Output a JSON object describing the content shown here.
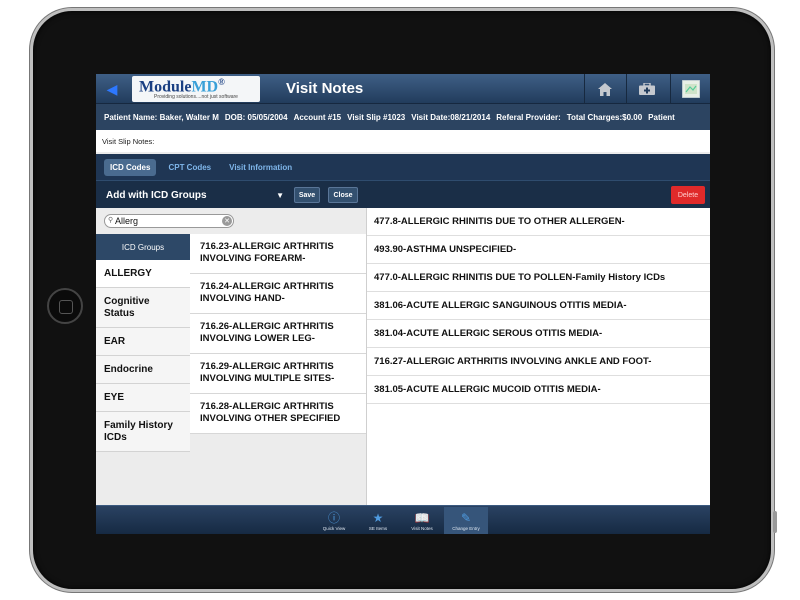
{
  "header": {
    "logo_main": "Module",
    "logo_accent": "MD",
    "logo_reg": "®",
    "logo_tagline": "Providing solutions....not just software",
    "title": "Visit Notes"
  },
  "patient_bar": {
    "items": [
      "Patient Name: Baker, Walter M",
      "DOB: 05/05/2004",
      "Account #15",
      "Visit Slip #1023",
      "Visit Date:08/21/2014",
      "Referal Provider:",
      "Total Charges:$0.00",
      "Patient"
    ]
  },
  "slip_notes_label": "Visit Slip Notes:",
  "tabs": [
    {
      "label": "ICD Codes"
    },
    {
      "label": "CPT Codes"
    },
    {
      "label": "Visit Information"
    }
  ],
  "actions": {
    "group_select": "Add with ICD Groups",
    "save": "Save",
    "close": "Close",
    "delete": "Delete"
  },
  "search": {
    "value": "Allerg"
  },
  "groups_header": "ICD Groups",
  "groups": [
    {
      "label": "ALLERGY"
    },
    {
      "label": "Cognitive Status"
    },
    {
      "label": "EAR"
    },
    {
      "label": "Endocrine"
    },
    {
      "label": "EYE"
    },
    {
      "label": "Family History ICDs"
    }
  ],
  "codes": [
    {
      "label": "716.23-ALLERGIC ARTHRITIS INVOLVING FOREARM-"
    },
    {
      "label": "716.24-ALLERGIC ARTHRITIS INVOLVING HAND-"
    },
    {
      "label": "716.26-ALLERGIC ARTHRITIS INVOLVING LOWER LEG-"
    },
    {
      "label": "716.29-ALLERGIC ARTHRITIS INVOLVING MULTIPLE SITES-"
    },
    {
      "label": "716.28-ALLERGIC ARTHRITIS INVOLVING OTHER SPECIFIED"
    }
  ],
  "selected_codes": [
    {
      "label": "477.8-ALLERGIC RHINITIS DUE TO OTHER ALLERGEN-"
    },
    {
      "label": "493.90-ASTHMA UNSPECIFIED-"
    },
    {
      "label": "477.0-ALLERGIC RHINITIS DUE TO POLLEN-Family History ICDs"
    },
    {
      "label": "381.06-ACUTE ALLERGIC SANGUINOUS OTITIS MEDIA-"
    },
    {
      "label": "381.04-ACUTE ALLERGIC SEROUS OTITIS MEDIA-"
    },
    {
      "label": "716.27-ALLERGIC ARTHRITIS INVOLVING ANKLE AND FOOT-"
    },
    {
      "label": "381.05-ACUTE ALLERGIC MUCOID OTITIS MEDIA-"
    }
  ],
  "bottom_tabs": [
    {
      "label": "Quick View",
      "icon": "info-icon"
    },
    {
      "label": "SE Items",
      "icon": "star-icon"
    },
    {
      "label": "Visit Notes",
      "icon": "book-icon"
    },
    {
      "label": "Change Entry",
      "icon": "edit-icon"
    }
  ],
  "colors": {
    "header": "#223c5c",
    "delete": "#e02a2a",
    "accent": "#4f9be0"
  }
}
